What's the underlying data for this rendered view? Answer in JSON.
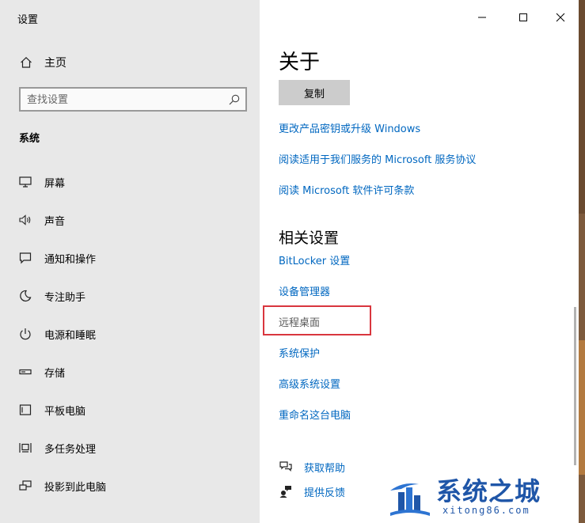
{
  "window": {
    "title": "设置"
  },
  "sidebar": {
    "home_label": "主页",
    "search": {
      "placeholder": "查找设置",
      "value": ""
    },
    "section_label": "系统",
    "items": [
      {
        "label": "屏幕",
        "icon": "monitor-icon"
      },
      {
        "label": "声音",
        "icon": "speaker-icon"
      },
      {
        "label": "通知和操作",
        "icon": "message-icon"
      },
      {
        "label": "专注助手",
        "icon": "moon-icon"
      },
      {
        "label": "电源和睡眠",
        "icon": "power-icon"
      },
      {
        "label": "存储",
        "icon": "storage-icon"
      },
      {
        "label": "平板电脑",
        "icon": "tablet-icon"
      },
      {
        "label": "多任务处理",
        "icon": "multitask-icon"
      },
      {
        "label": "投影到此电脑",
        "icon": "project-icon"
      }
    ]
  },
  "main": {
    "heading": "关于",
    "copy_button": "复制",
    "links": [
      "更改产品密钥或升级 Windows",
      "阅读适用于我们服务的 Microsoft 服务协议",
      "阅读 Microsoft 软件许可条款"
    ],
    "related_heading": "相关设置",
    "related_links": [
      "BitLocker 设置",
      "设备管理器",
      "远程桌面",
      "系统保护",
      "高级系统设置",
      "重命名这台电脑"
    ],
    "help_links": [
      {
        "label": "获取帮助",
        "icon": "help-chat-icon"
      },
      {
        "label": "提供反馈",
        "icon": "feedback-icon"
      }
    ]
  },
  "watermark": {
    "title": "系统之城",
    "subtitle": "xitong86.com"
  },
  "colors": {
    "link": "#0067c0",
    "highlight": "#d9363e",
    "sidebar_bg": "#e8e8e8"
  }
}
